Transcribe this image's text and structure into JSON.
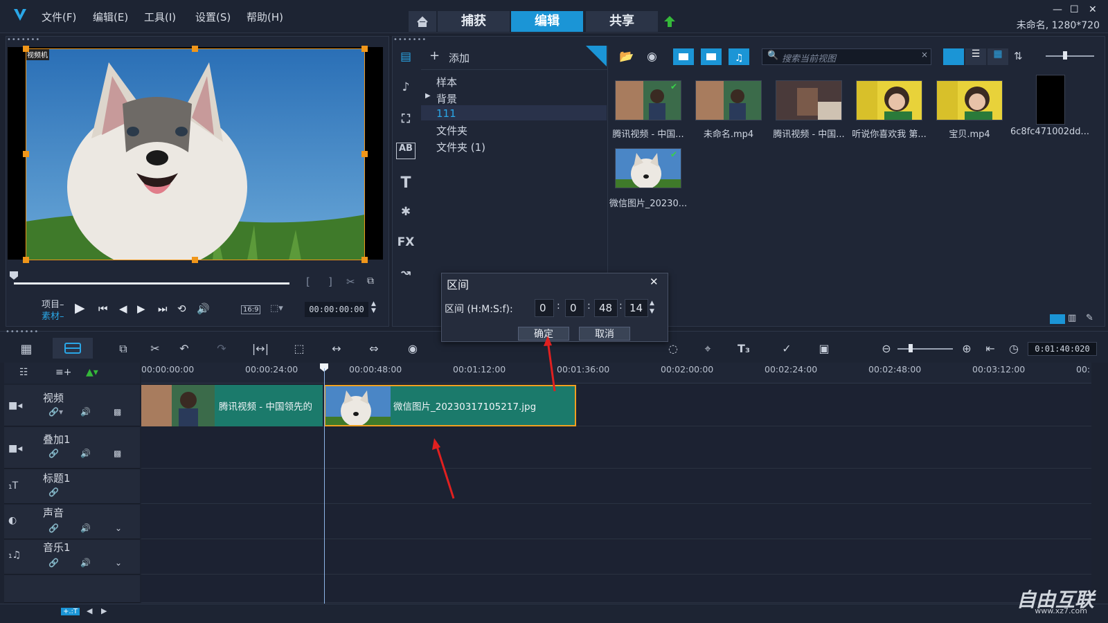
{
  "menu": [
    "文件(F)",
    "编辑(E)",
    "工具(I)",
    "设置(S)",
    "帮助(H)"
  ],
  "nav": {
    "capture": "捕获",
    "edit": "编辑",
    "share": "共享"
  },
  "project_info": "未命名, 1280*720",
  "preview": {
    "corner_label": "视频机",
    "mode_project": "项目",
    "mode_clip": "素材",
    "aspect": "16:9",
    "timecode": "00:00:00:00"
  },
  "library": {
    "add_label": "添加",
    "folders": [
      "样本",
      "背景",
      "111",
      "文件夹",
      "文件夹 (1)"
    ],
    "search_placeholder": "搜索当前视图",
    "media": [
      "腾讯视频 - 中国...",
      "未命名.mp4",
      "腾讯视频 - 中国...",
      "听说你喜欢我 第...",
      "宝贝.mp4",
      "6c8fc471002dd...",
      "微信图片_20230..."
    ]
  },
  "dialog": {
    "title": "区间",
    "label": "区间 (H:M:S:f):",
    "h": "0",
    "m": "0",
    "s": "48",
    "f": "14",
    "ok": "确定",
    "cancel": "取消"
  },
  "toolbar": {
    "project_duration": "0:01:40:020"
  },
  "ruler_ticks": [
    "00:00:00:00",
    "00:00:24:00",
    "00:00:48:00",
    "00:01:12:00",
    "00:01:36:00",
    "00:02:00:00",
    "00:02:24:00",
    "00:02:48:00",
    "00:03:12:00",
    "00:"
  ],
  "tracks": [
    "视频",
    "叠加1",
    "标题1",
    "声音",
    "音乐1"
  ],
  "clips": {
    "video1": "腾讯视频 - 中国领先的",
    "image1": "微信图片_20230317105217.jpg"
  },
  "watermark": "自由互联",
  "watermark_url": "www.xz7.com"
}
